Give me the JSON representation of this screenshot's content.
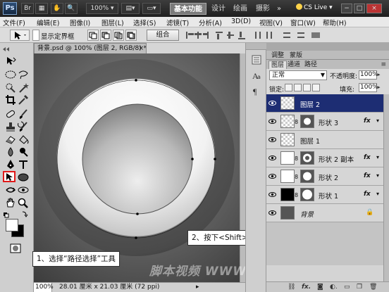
{
  "titlebar": {
    "app_logo": "Ps",
    "zoom": "100%",
    "workspaces": [
      "基本功能",
      "设计",
      "绘画",
      "摄影"
    ],
    "more": "»",
    "cs_live": "CS Live",
    "window_controls": [
      "−",
      "□",
      "×"
    ]
  },
  "menu": [
    "文件(F)",
    "编辑(E)",
    "图像(I)",
    "图层(L)",
    "选择(S)",
    "滤镜(T)",
    "分析(A)",
    "3D(D)",
    "视图(V)",
    "窗口(W)",
    "帮助(H)"
  ],
  "options": {
    "show_bbox_label": "显示定界框",
    "combine_label": "组合"
  },
  "document": {
    "tab_title": "背景.psd @ 100% (图层 2, RGB/8) *",
    "tab_close": "×",
    "zoom": "100%",
    "info": "28.01 厘米 x 21.03 厘米 (72 ppi)"
  },
  "callouts": {
    "step1": "1、选择“路径选择”工具",
    "step2": "2、按下<Shift>键将两个路径同时选中"
  },
  "watermark": "脚本视频 WWW.TLVI.NET",
  "panel_tabs_top": [
    "调整",
    "蒙版"
  ],
  "panel_tabs_layers": [
    "图层",
    "通道",
    "路径"
  ],
  "layers_panel": {
    "blend_mode": "正常",
    "opacity_label": "不透明度:",
    "opacity": "100%",
    "lock_label": "锁定:",
    "fill_label": "填充:",
    "fill": "100%",
    "layers": [
      {
        "name": "图层 2",
        "thumb": "checker",
        "selected": true,
        "vector_mask": false,
        "fx": false
      },
      {
        "name": "形状 3",
        "thumb": "checker",
        "selected": false,
        "vector_mask": true,
        "fx": true
      },
      {
        "name": "图层 1",
        "thumb": "checker",
        "selected": false,
        "vector_mask": false,
        "fx": false
      },
      {
        "name": "形状 2 副本",
        "thumb": "white",
        "selected": false,
        "vector_mask": true,
        "fx": true
      },
      {
        "name": "形状 2",
        "thumb": "white",
        "selected": false,
        "vector_mask": true,
        "fx": true
      },
      {
        "name": "形状 1",
        "thumb": "black",
        "selected": false,
        "vector_mask": true,
        "fx": true
      },
      {
        "name": "背景",
        "thumb": "dark",
        "selected": false,
        "vector_mask": false,
        "fx": false,
        "locked": true
      }
    ],
    "fx_label": "fx",
    "bottom_icons": [
      "link-icon",
      "fx-icon",
      "mask-icon",
      "adjustment-icon",
      "folder-icon",
      "new-layer-icon",
      "trash-icon"
    ]
  },
  "colors": {
    "selected_layer": "#1d2d73",
    "tool_highlight": "#e01a1a",
    "canvas_bg": "#737373"
  }
}
